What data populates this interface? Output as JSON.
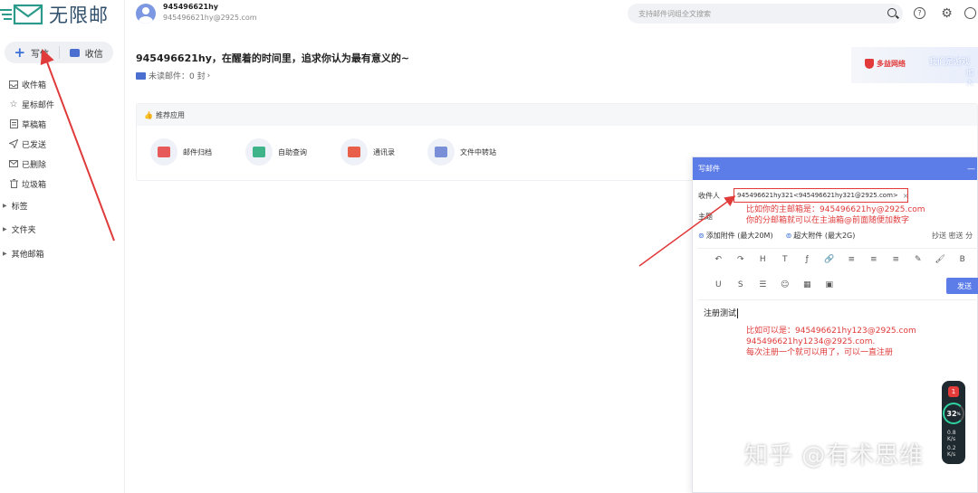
{
  "app": {
    "logo_text": "无限邮"
  },
  "sidebar": {
    "compose_label": "写信",
    "receive_label": "收信",
    "items": [
      {
        "label": "收件箱",
        "icon": "inbox-icon"
      },
      {
        "label": "星标邮件",
        "icon": "star-icon"
      },
      {
        "label": "草稿箱",
        "icon": "draft-icon"
      },
      {
        "label": "已发送",
        "icon": "sent-icon"
      },
      {
        "label": "已删除",
        "icon": "deleted-icon"
      },
      {
        "label": "垃圾箱",
        "icon": "trash-icon"
      }
    ],
    "groups": [
      {
        "label": "标签"
      },
      {
        "label": "文件夹"
      },
      {
        "label": "其他邮箱"
      }
    ]
  },
  "header": {
    "user_name": "945496621hy",
    "user_email": "945496621hy@2925.com",
    "search_placeholder": "支持邮件词组全文搜索"
  },
  "main": {
    "greeting": "945496621hy，在醒着的时间里，追求你认为最有意义的~",
    "unread": "未读邮件：0 封",
    "unread_arrow": "›",
    "banner_logo": "多益网络",
    "banner_text": "我们是游戏",
    "banner_sub": "加入",
    "apps_title": "推荐应用",
    "apps": [
      {
        "label": "邮件归档",
        "color": "#e85a5a"
      },
      {
        "label": "自助查询",
        "color": "#3fb48a"
      },
      {
        "label": "通讯录",
        "color": "#e8604a"
      },
      {
        "label": "文件中转站",
        "color": "#7a8fd8"
      }
    ]
  },
  "compose": {
    "title": "写邮件",
    "to_label": "收件人",
    "recipient": "945496621hy321<945496621hy321@2925.com>",
    "recipient_remove": "×",
    "subject_label": "主题",
    "attach_label": "添加附件 (最大20M)",
    "big_attach_label": "超大附件 (最大2G)",
    "cc_links": "抄送  密送  分",
    "send_label": "发送",
    "body_text": "注册测试",
    "toolbar_row1": [
      "↶",
      "↷",
      "H",
      "T",
      "ƒ",
      "🔗",
      "≡",
      "≡",
      "≡",
      "✎",
      "🖌",
      "B"
    ],
    "toolbar_row2": [
      "U",
      "S",
      "☰",
      "☺",
      "▦",
      "▣"
    ]
  },
  "annotations": {
    "note1_line1": "比如你的主邮箱是：945496621hy@2925.com",
    "note1_line2": "你的分邮箱就可以在主油箱@前面随便加数字",
    "note2_line1": "比如可以是：945496621hy123@2925.com",
    "note2_line2": "945496621hy1234@2925.com.",
    "note2_line3": "每次注册一个就可以用了，可以一直注册"
  },
  "net_widget": {
    "badge": "1",
    "value": "32",
    "unit": "%",
    "up": "0.8",
    "up_unit": "K/s",
    "down": "0.2",
    "down_unit": "K/s"
  },
  "watermark": "知乎 @有术思维",
  "colors": {
    "accent": "#5c7ce8",
    "annotation_red": "#e03a3a"
  }
}
